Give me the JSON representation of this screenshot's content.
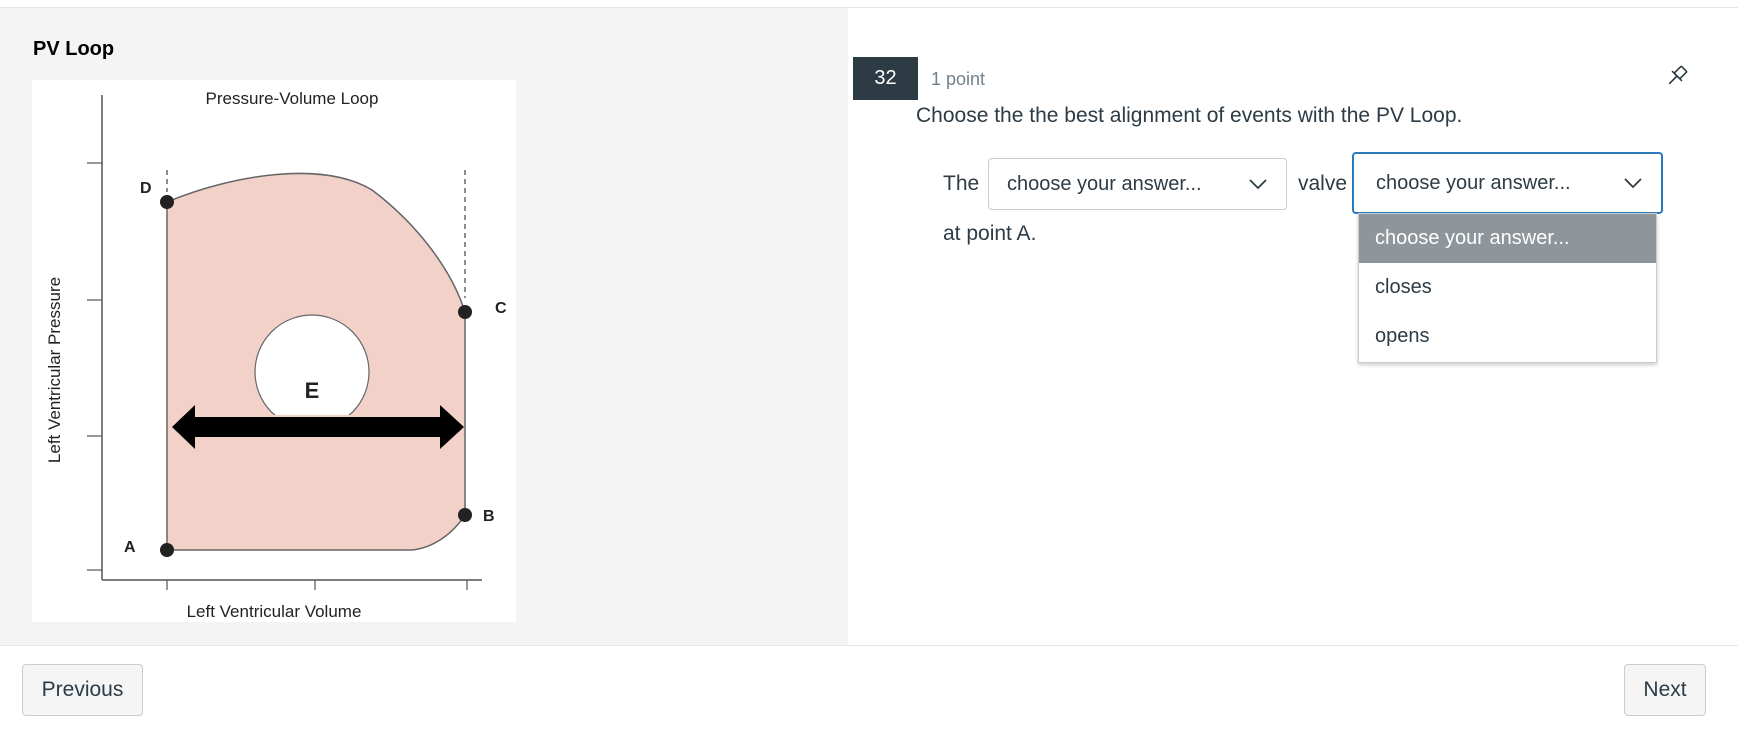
{
  "stimulus": {
    "title": "PV Loop",
    "figure": {
      "title": "Pressure-Volume Loop",
      "ylabel": "Left Ventricular Pressure",
      "xlabel": "Left Ventricular Volume",
      "points": {
        "a": "A",
        "b": "B",
        "c": "C",
        "d": "D",
        "e": "E"
      },
      "loop_color": "#f2d2c8"
    }
  },
  "question": {
    "number": "32",
    "points": "1 point",
    "text": "Choose the the best alignment of events with the PV Loop.",
    "word_the": "The",
    "word_valve": "valve",
    "word_end": "at point A.",
    "select1": {
      "value": "choose your answer..."
    },
    "select2": {
      "value": "choose your answer..."
    },
    "dropdown_options": [
      "choose your answer...",
      "closes",
      "opens"
    ]
  },
  "nav": {
    "previous": "Previous",
    "next": "Next"
  },
  "colors": {
    "accent": "#2b7abc",
    "badge": "#2d3b45",
    "option_highlight": "#8e959b"
  }
}
